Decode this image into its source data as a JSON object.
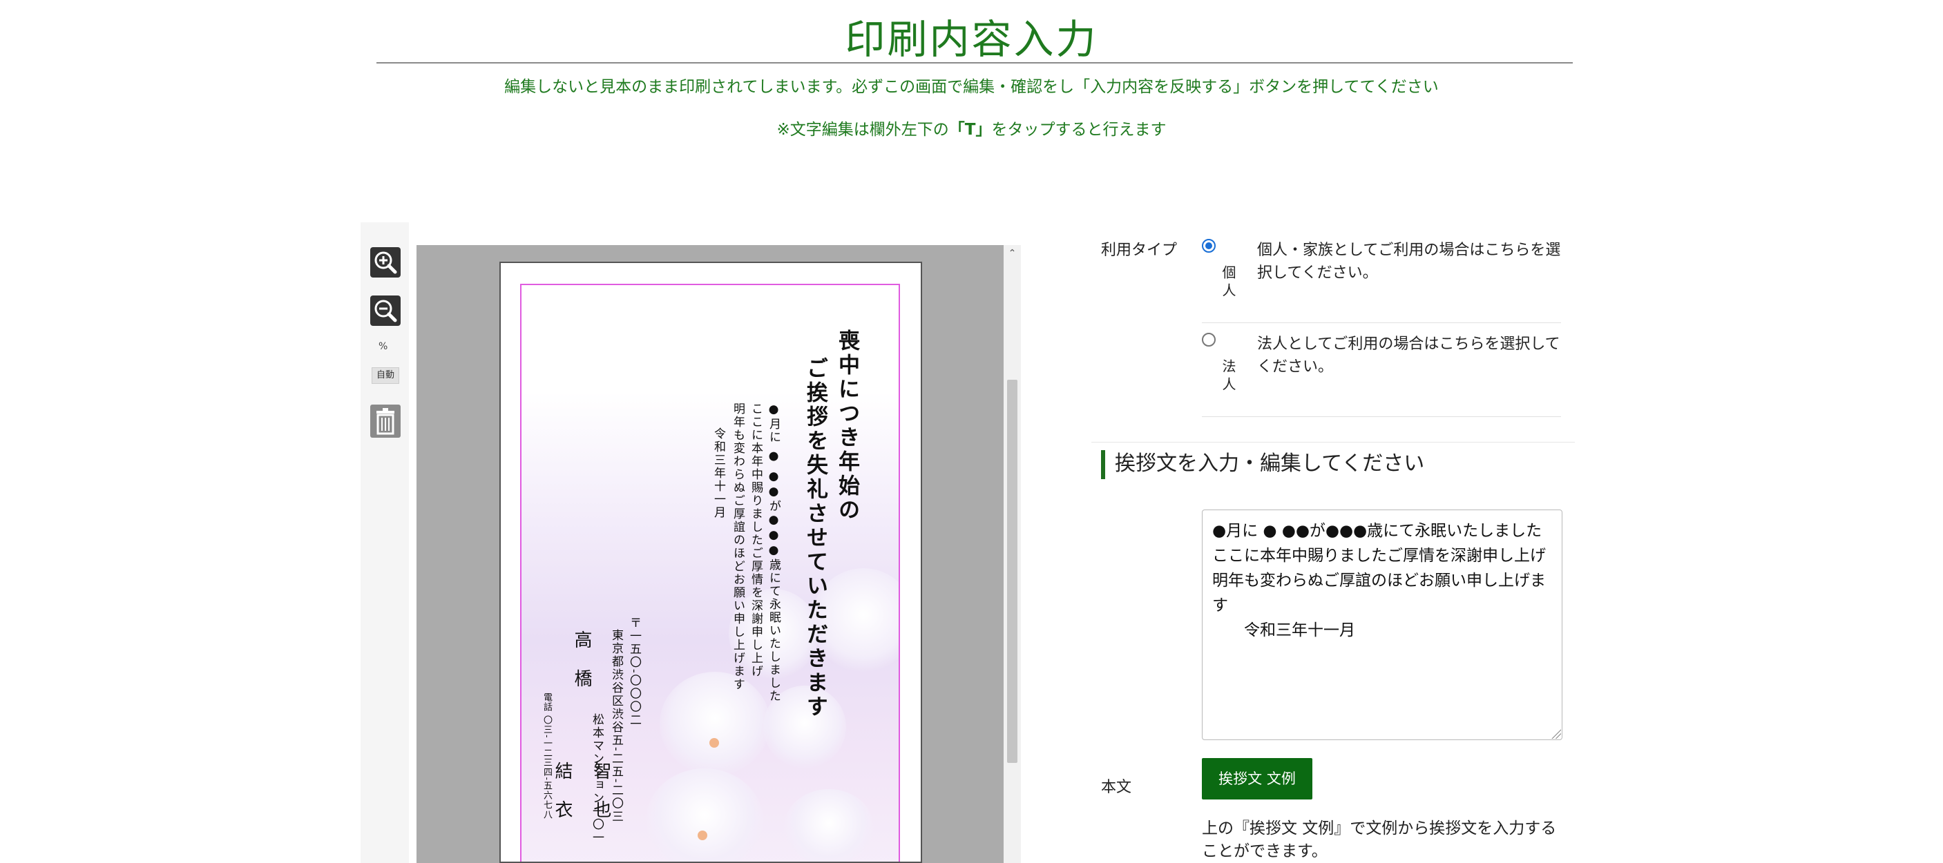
{
  "header": {
    "title": "印刷内容入力",
    "notice_1": "編集しないと見本のまま印刷されてしまいます。必ずこの画面で編集・確認をし「入力内容を反映する」ボタンを押しててください",
    "notice_2_prefix": "※文字編集は欄外左下の",
    "notice_2_key": "「T」",
    "notice_2_suffix": "をタップすると行えます"
  },
  "tools": {
    "zoom_in_icon": "zoom-in-icon",
    "zoom_out_icon": "zoom-out-icon",
    "percent": "%",
    "auto_label": "自動",
    "trash_icon": "trash-icon"
  },
  "card": {
    "heading_1": "喪中につき年始の",
    "heading_2": "ご挨拶を失礼させていただきます",
    "body_lines": [
      "●月に ● ●●が●●●歳にて永眠いたしました",
      "ここに本年中賜りましたご厚情を深謝申し上げ",
      "明年も変わらぬご厚誼のほどお願い申し上げます",
      "令和三年十一月"
    ],
    "postal": "〒一五〇-〇〇〇二",
    "address_1": "東京都渋谷区渋谷五-二五-二〇三",
    "address_2": "松本マンション一〇一",
    "names": [
      "高橋",
      "智也",
      "結衣"
    ],
    "tel": "電話 〇三-一二三四-五六七八"
  },
  "form": {
    "usage_label": "利用タイプ",
    "options": [
      {
        "name": "個人",
        "desc": "個人・家族としてご利用の場合はこちらを選択してください。",
        "checked": true
      },
      {
        "name": "法人",
        "desc": "法人としてご利用の場合はこちらを選択してください。",
        "checked": false
      }
    ],
    "section_heading": "挨拶文を入力・編集してください",
    "message": "●月に ● ●●が●●●歳にて永眠いたしました\nここに本年中賜りましたご厚情を深謝申し上げ\n明年も変わらぬご厚誼のほどお願い申し上げます\n　　令和三年十一月",
    "honbun_label": "本文",
    "sample_button": "挨拶文 文例",
    "sample_note": "上の『挨拶文 文例』で文例から挨拶文を入力することができます。"
  },
  "colors": {
    "accent_green": "#1f7a1f",
    "button_green": "#0b6a12",
    "print_border": "#e05ce0",
    "radio_blue": "#1a6fd6"
  }
}
